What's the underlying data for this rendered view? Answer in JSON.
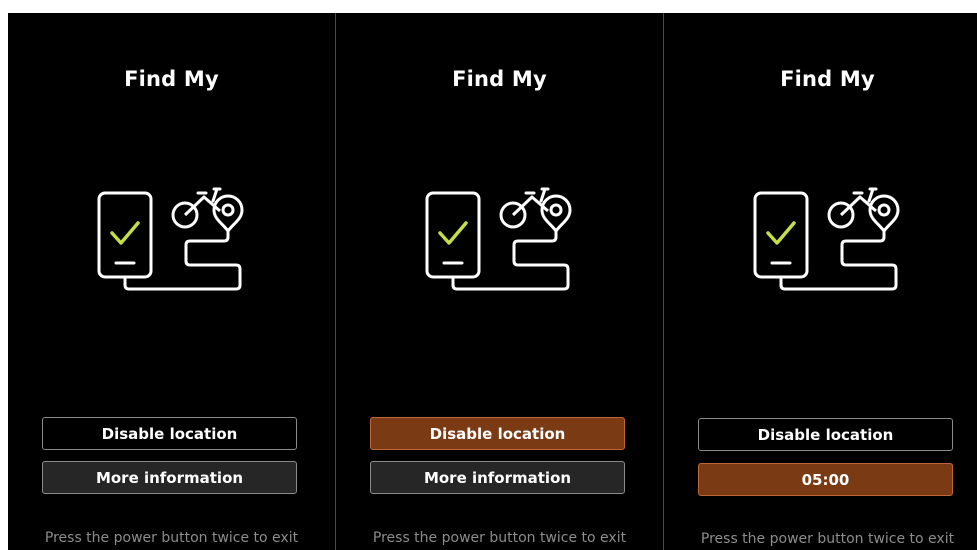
{
  "colors": {
    "background": "#000000",
    "accent": "#7a3a14",
    "accent_border": "#c0673a",
    "check": "#c6dd4a",
    "hint": "#8c8c8c"
  },
  "icons": [
    "phone-check-icon",
    "bike-location-icon"
  ],
  "panels": [
    {
      "title": "Find My",
      "primary_button": "Disable location",
      "secondary_button": "More information",
      "hint": "Press the power button twice to exit"
    },
    {
      "title": "Find My",
      "primary_button": "Disable location",
      "secondary_button": "More information",
      "hint": "Press the power button twice to exit"
    },
    {
      "title": "Find My",
      "primary_button": "Disable location",
      "secondary_button": "05:00",
      "hint": "Press the power button twice to exit"
    }
  ]
}
